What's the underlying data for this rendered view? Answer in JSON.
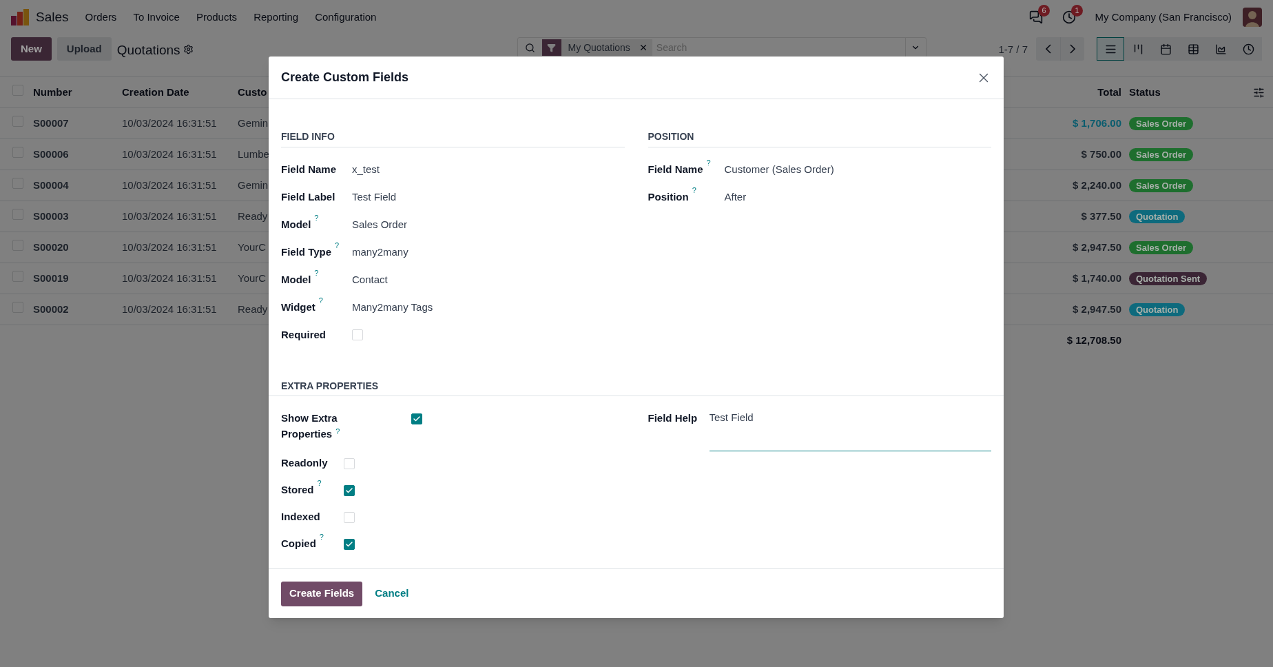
{
  "app": {
    "name": "Sales",
    "menu": [
      "Orders",
      "To Invoice",
      "Products",
      "Reporting",
      "Configuration"
    ],
    "notifications": [
      {
        "kind": "chat",
        "count": "6"
      },
      {
        "kind": "activity",
        "count": "1"
      }
    ],
    "company": "My Company (San Francisco)"
  },
  "control_panel": {
    "buttons": [
      {
        "label": "New",
        "kind": "primary"
      },
      {
        "label": "Upload",
        "kind": "secondary"
      }
    ],
    "title": "Quotations",
    "facet": "My Quotations",
    "search_placeholder": "Search",
    "pager": "1-7 / 7",
    "views": [
      {
        "kind": "list",
        "selected": true
      },
      {
        "kind": "kanban",
        "selected": false
      },
      {
        "kind": "calendar",
        "selected": false
      },
      {
        "kind": "pivot",
        "selected": false
      },
      {
        "kind": "graph",
        "selected": false
      },
      {
        "kind": "activity",
        "selected": false
      }
    ]
  },
  "table": {
    "select_all_checked": false,
    "columns": [
      "Number",
      "Creation Date",
      "Custo",
      "Total",
      "Status"
    ],
    "rows": [
      {
        "checked": false,
        "number": "S00007",
        "date": "10/03/2024 16:31:51",
        "customer": "Gemin",
        "total": "$ 1,706.00",
        "highlighted": true,
        "status": {
          "label": "Sales Order",
          "color": "#1e6e2e"
        }
      },
      {
        "checked": false,
        "number": "S00006",
        "date": "10/03/2024 16:31:51",
        "customer": "Lumbe",
        "total": "$ 750.00",
        "highlighted": false,
        "status": {
          "label": "Sales Order",
          "color": "#1e6e2e"
        }
      },
      {
        "checked": false,
        "number": "S00004",
        "date": "10/03/2024 16:31:51",
        "customer": "Gemin",
        "total": "$ 2,240.00",
        "highlighted": false,
        "status": {
          "label": "Sales Order",
          "color": "#1e6e2e"
        }
      },
      {
        "checked": false,
        "number": "S00003",
        "date": "10/03/2024 16:31:51",
        "customer": "Ready",
        "total": "$ 377.50",
        "highlighted": false,
        "status": {
          "label": "Quotation",
          "color": "#0e6a7d"
        }
      },
      {
        "checked": false,
        "number": "S00020",
        "date": "10/03/2024 16:31:51",
        "customer": "YourC",
        "total": "$ 2,947.50",
        "highlighted": false,
        "status": {
          "label": "Sales Order",
          "color": "#1e6e2e"
        }
      },
      {
        "checked": false,
        "number": "S00019",
        "date": "10/03/2024 16:31:51",
        "customer": "YourC",
        "total": "$ 1,740.00",
        "highlighted": false,
        "status": {
          "label": "Quotation Sent",
          "color": "#3b2535"
        }
      },
      {
        "checked": false,
        "number": "S00002",
        "date": "10/03/2024 16:31:51",
        "customer": "Ready",
        "total": "$ 2,947.50",
        "highlighted": false,
        "status": {
          "label": "Quotation",
          "color": "#0e6a7d"
        }
      }
    ],
    "sum": "$ 12,708.50"
  },
  "dialog": {
    "title": "Create Custom Fields",
    "sections": [
      {
        "heading": "FIELD INFO",
        "fields": [
          {
            "kind": "text",
            "label": "Field Name",
            "value": "x_test"
          },
          {
            "kind": "text",
            "label": "Field Label",
            "value": "Test Field"
          },
          {
            "kind": "text",
            "label": "Model",
            "help": "?",
            "value": "Sales Order"
          },
          {
            "kind": "text",
            "label": "Field Type",
            "help": "?",
            "value": "many2many"
          },
          {
            "kind": "text",
            "label": "Model",
            "help": "?",
            "value": "Contact"
          },
          {
            "kind": "text",
            "label": "Widget",
            "help": "?",
            "value": "Many2many Tags"
          },
          {
            "kind": "checkbox",
            "label": "Required",
            "checked": false
          }
        ]
      },
      {
        "heading": "POSITION",
        "fields": [
          {
            "kind": "text",
            "label": "Field Name",
            "help": "?",
            "value": "Customer (Sales Order)"
          },
          {
            "kind": "text",
            "label": "Position",
            "help": "?",
            "value": "After"
          }
        ]
      }
    ],
    "extra": {
      "heading": "EXTRA PROPERTIES",
      "show_extra": {
        "label": "Show Extra Properties",
        "help": "?",
        "checked": true
      },
      "flags": [
        {
          "label": "Readonly",
          "checked": false
        },
        {
          "label": "Stored",
          "help": "?",
          "checked": true
        },
        {
          "label": "Indexed",
          "checked": false
        },
        {
          "label": "Copied",
          "help": "?",
          "checked": true
        }
      ],
      "field_help": {
        "label": "Field Help",
        "value": "Test Field"
      }
    },
    "buttons": [
      {
        "label": "Create Fields",
        "kind": "primary"
      },
      {
        "label": "Cancel",
        "kind": "link"
      }
    ]
  }
}
